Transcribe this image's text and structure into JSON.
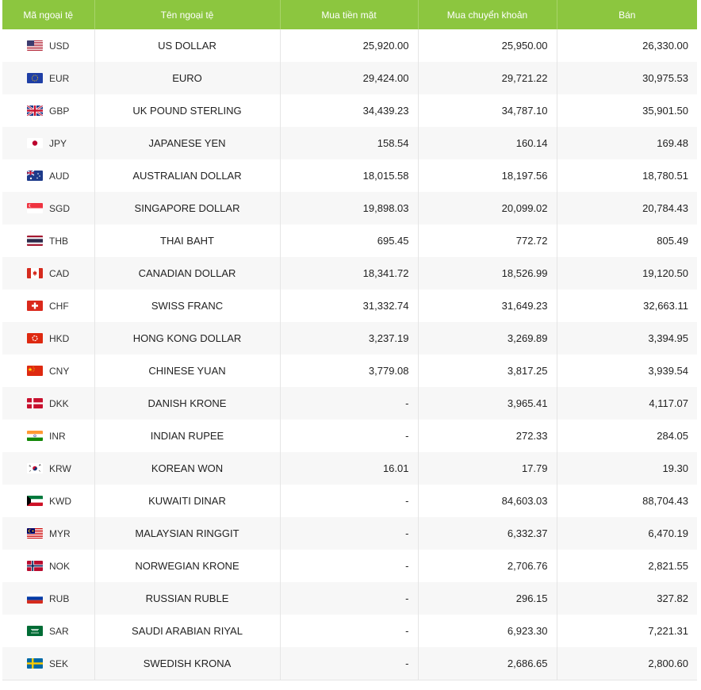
{
  "header": {
    "code": "Mã ngoại tệ",
    "name": "Tên ngoại tệ",
    "cash_buy": "Mua tiền mặt",
    "transfer_buy": "Mua chuyển khoản",
    "sell": "Bán"
  },
  "rows": [
    {
      "code": "USD",
      "name": "US DOLLAR",
      "cash": "25,920.00",
      "transfer": "25,950.00",
      "sell": "26,330.00",
      "flag": "us-flag-icon"
    },
    {
      "code": "EUR",
      "name": "EURO",
      "cash": "29,424.00",
      "transfer": "29,721.22",
      "sell": "30,975.53",
      "flag": "eu-flag-icon"
    },
    {
      "code": "GBP",
      "name": "UK POUND STERLING",
      "cash": "34,439.23",
      "transfer": "34,787.10",
      "sell": "35,901.50",
      "flag": "uk-flag-icon"
    },
    {
      "code": "JPY",
      "name": "JAPANESE YEN",
      "cash": "158.54",
      "transfer": "160.14",
      "sell": "169.48",
      "flag": "jp-flag-icon"
    },
    {
      "code": "AUD",
      "name": "AUSTRALIAN DOLLAR",
      "cash": "18,015.58",
      "transfer": "18,197.56",
      "sell": "18,780.51",
      "flag": "au-flag-icon"
    },
    {
      "code": "SGD",
      "name": "SINGAPORE DOLLAR",
      "cash": "19,898.03",
      "transfer": "20,099.02",
      "sell": "20,784.43",
      "flag": "sg-flag-icon"
    },
    {
      "code": "THB",
      "name": "THAI BAHT",
      "cash": "695.45",
      "transfer": "772.72",
      "sell": "805.49",
      "flag": "th-flag-icon"
    },
    {
      "code": "CAD",
      "name": "CANADIAN DOLLAR",
      "cash": "18,341.72",
      "transfer": "18,526.99",
      "sell": "19,120.50",
      "flag": "ca-flag-icon"
    },
    {
      "code": "CHF",
      "name": "SWISS FRANC",
      "cash": "31,332.74",
      "transfer": "31,649.23",
      "sell": "32,663.11",
      "flag": "ch-flag-icon"
    },
    {
      "code": "HKD",
      "name": "HONG KONG DOLLAR",
      "cash": "3,237.19",
      "transfer": "3,269.89",
      "sell": "3,394.95",
      "flag": "hk-flag-icon"
    },
    {
      "code": "CNY",
      "name": "CHINESE YUAN",
      "cash": "3,779.08",
      "transfer": "3,817.25",
      "sell": "3,939.54",
      "flag": "cn-flag-icon"
    },
    {
      "code": "DKK",
      "name": "DANISH KRONE",
      "cash": "-",
      "transfer": "3,965.41",
      "sell": "4,117.07",
      "flag": "dk-flag-icon"
    },
    {
      "code": "INR",
      "name": "INDIAN RUPEE",
      "cash": "-",
      "transfer": "272.33",
      "sell": "284.05",
      "flag": "in-flag-icon"
    },
    {
      "code": "KRW",
      "name": "KOREAN WON",
      "cash": "16.01",
      "transfer": "17.79",
      "sell": "19.30",
      "flag": "kr-flag-icon"
    },
    {
      "code": "KWD",
      "name": "KUWAITI DINAR",
      "cash": "-",
      "transfer": "84,603.03",
      "sell": "88,704.43",
      "flag": "kw-flag-icon"
    },
    {
      "code": "MYR",
      "name": "MALAYSIAN RINGGIT",
      "cash": "-",
      "transfer": "6,332.37",
      "sell": "6,470.19",
      "flag": "my-flag-icon"
    },
    {
      "code": "NOK",
      "name": "NORWEGIAN KRONE",
      "cash": "-",
      "transfer": "2,706.76",
      "sell": "2,821.55",
      "flag": "no-flag-icon"
    },
    {
      "code": "RUB",
      "name": "RUSSIAN RUBLE",
      "cash": "-",
      "transfer": "296.15",
      "sell": "327.82",
      "flag": "ru-flag-icon"
    },
    {
      "code": "SAR",
      "name": "SAUDI ARABIAN RIYAL",
      "cash": "-",
      "transfer": "6,923.30",
      "sell": "7,221.31",
      "flag": "sa-flag-icon"
    },
    {
      "code": "SEK",
      "name": "SWEDISH KRONA",
      "cash": "-",
      "transfer": "2,686.65",
      "sell": "2,800.60",
      "flag": "se-flag-icon"
    }
  ],
  "colors": {
    "header_bg": "#8cc63f",
    "header_text": "#ffffff",
    "row_alt": "#f7f7f7"
  }
}
